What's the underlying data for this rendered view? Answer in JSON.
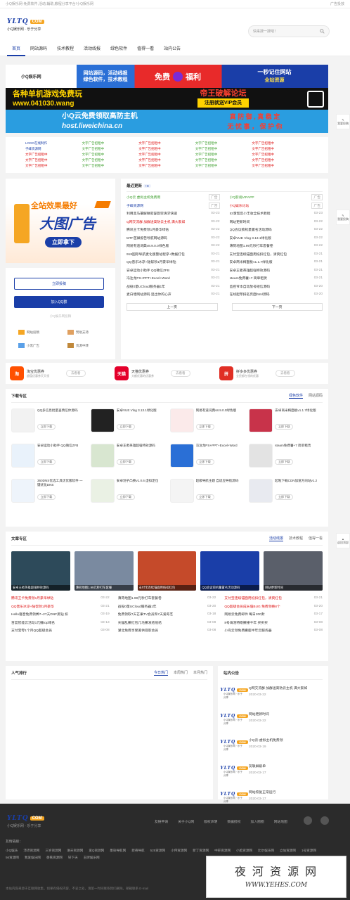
{
  "topbar": {
    "left": "小Q娱乐网-免费软件,活动,辅助,教程分享平台!小Q娱乐网",
    "right": "广告投放"
  },
  "logo": {
    "text": "YLTQ",
    "com": "COM",
    "sub": "小Q娱乐网 · 乐于分享"
  },
  "search": {
    "placeholder": "快来搜一搜吧！"
  },
  "nav": [
    "首页",
    "网站源码",
    "技术教程",
    "活动线报",
    "绿色软件",
    "值得一看",
    "站内公告"
  ],
  "banners": {
    "b1a": "小Q娱乐网",
    "b1b": "网站源码，活动线报",
    "b1c": "绿色软件，技术教程",
    "b1d": "免费",
    "b1e": "福利",
    "b1f": "一秒记住网站",
    "b1g": "全站资源",
    "b2a": "各种单机游戏免费玩",
    "b2b": "www.041030.wang",
    "b2c": "帝王破解论坛",
    "b2d": "注册就送VIP会员",
    "b3a": "小Q云免费领取高防主机",
    "b3b": "host.liweichina.cn",
    "b3c": "真 防 御 , 真 稳 定",
    "b3d": "无 忧 事 ， 保 护 你"
  },
  "textlinks": [
    [
      "LOGO在线制作",
      "文字广告招租中",
      "文字广告招租中",
      "文字广告招租中",
      "文字广告招租中"
    ],
    [
      "子峰资源网",
      "文字广告招租中",
      "文字广告招租中",
      "文字广告招租中",
      "文字广告招租中"
    ],
    [
      "文字广告招租中",
      "文字广告招租中",
      "文字广告招租中",
      "文字广告招租中",
      "文字广告招租中"
    ],
    [
      "文字广告招租中",
      "文字广告招租中",
      "文字广告招租中",
      "文字广告招租中",
      "文字广告招租中"
    ],
    [
      "文字广告招租中",
      "文字广告招租中",
      "文字广告招租中",
      "文字广告招租中",
      "文字广告招租中"
    ]
  ],
  "bigad": {
    "l1": "全站效果最好",
    "l2": "大图广告",
    "l3": "立即拿下"
  },
  "user": {
    "btn1": "立即投稿",
    "btn2": "加入QQ群",
    "sub": "小Q娱乐网投稿",
    "i1": "网站投稿",
    "i2": "赞助支持",
    "i3": "小黑广告",
    "i4": "资源中转"
  },
  "news": {
    "title": "最近更新",
    "badge": "+8",
    "left": [
      {
        "t": "小Q云 虚拟主机免费用",
        "d": "广告",
        "c": "g"
      },
      {
        "t": "子峰资源网",
        "d": "广告",
        "c": "b"
      },
      {
        "t": "利用黑马攘解微密容旋空请求快速",
        "d": "03-23",
        "c": ""
      },
      {
        "t": "Q网交流群 加群送高防云主机 满大家如",
        "d": "03-22",
        "c": "r"
      },
      {
        "t": "腾讯王卡免费领1月豪华绿钻",
        "d": "03-22",
        "c": ""
      },
      {
        "t": "MTF首屏报告导航网站源码",
        "d": "03-22",
        "c": ""
      },
      {
        "t": "网易有道词典v8.9.0.0绿色版",
        "d": "03-22",
        "c": ""
      },
      {
        "t": "918国际导航麦化版整站程序+数据打包",
        "d": "03-21",
        "c": ""
      },
      {
        "t": "QQ音乐冰凉+陆帮领1月豪华绿钻",
        "d": "03-21",
        "c": ""
      },
      {
        "t": "安卓运动小助手 QQ微信ZFB",
        "d": "03-21",
        "c": ""
      },
      {
        "t": "冯注龙PS+PPT+Excel+Word",
        "d": "03-21",
        "c": ""
      },
      {
        "t": "战役0量UCloud服务器1年",
        "d": "03-21",
        "c": ""
      },
      {
        "t": "麦白墙网站源码 追出你的心声",
        "d": "03-21",
        "c": ""
      }
    ],
    "right": [
      {
        "t": "小Q影视VIPAPP",
        "d": "广告",
        "c": "g"
      },
      {
        "t": "小Q娱乐论坛",
        "d": "广告",
        "c": "r"
      },
      {
        "t": "63掌帮您小丰收全技术教程",
        "d": "03-23",
        "c": ""
      },
      {
        "t": "网站更新时间",
        "d": "03-22",
        "c": ""
      },
      {
        "t": "QQ会议锁机量置名活动源码",
        "d": "03-22",
        "c": ""
      },
      {
        "t": "安卓VUE Vlog 3.13.1绿化版",
        "d": "03-22",
        "c": ""
      },
      {
        "t": "薄荷地图1.99元秒打车套餐卷",
        "d": "03-22",
        "c": ""
      },
      {
        "t": "支付宝连续锚面用抵扣红包，清爽红包",
        "d": "03-21",
        "c": ""
      },
      {
        "t": "安卓商米梅面板v1.1.7绿化版",
        "d": "03-21",
        "c": ""
      },
      {
        "t": "安卓王者英雄超强特效源码",
        "d": "03-21",
        "c": ""
      },
      {
        "t": "steam免费薯+7 简单租赁",
        "d": "03-21",
        "c": ""
      },
      {
        "t": "监控爷本自动放号短信源码",
        "d": "03-20",
        "c": ""
      },
      {
        "t": "在线起草排名页面html源码",
        "d": "03-20",
        "c": ""
      }
    ],
    "prev": "上一页",
    "next": "下一页"
  },
  "coupons": [
    {
      "icon": "淘",
      "title": "淘宝优惠券",
      "sub": "超值优惠券天天领",
      "btn": "去看看",
      "color": "#ff5000"
    },
    {
      "icon": "天猫",
      "title": "天猫优惠券",
      "sub": "大额优惠的优惠券",
      "btn": "去看看",
      "color": "#e4002b"
    },
    {
      "icon": "拼",
      "title": "拼多多优惠券",
      "sub": "全民都在领的优惠",
      "btn": "去看看",
      "color": "#e02e24"
    }
  ],
  "download": {
    "title": "下载专区",
    "tabs": [
      "绿色软件",
      "网站源码"
    ],
    "items": [
      {
        "t": "QQ多信息批量查情信体源码",
        "b": "立即下载",
        "c": "#f2f2f2"
      },
      {
        "t": "安卓VUE Vlog 3.13.1绿化版",
        "b": "立即下载",
        "c": "#222"
      },
      {
        "t": "网易有道词典v8.9.0.0绿色版",
        "b": "立即下载",
        "c": "#fbeaea"
      },
      {
        "t": "安卓商米梅面板v1.1.7绿化版",
        "b": "立即下载",
        "c": "#c8334a"
      },
      {
        "t": "安卓运动小助手 QQ微信ZFB",
        "b": "立即下载",
        "c": "#e9f2fb"
      },
      {
        "t": "安卓王者英雄超强特效源码",
        "b": "立即下载",
        "c": "#d8e6d0"
      },
      {
        "t": "冯注龙PS+PPT+Excel+Word",
        "b": "立即下载",
        "c": "#2a6fd6"
      },
      {
        "t": "steam免费薯+7 简单租赁",
        "b": "立即下载",
        "c": "#e3e3e3"
      },
      {
        "t": "360DNS优选工具优优版软件 一键优化DNS",
        "b": "立即下载",
        "c": "#eef4fb"
      },
      {
        "t": "安卓划子凸换v1.0.6 虚拟定位",
        "b": "立即下载",
        "c": "#eaf1e4"
      },
      {
        "t": "超级导航主题 自适应导航源码",
        "b": "立即下载",
        "c": "#f4f4f4"
      },
      {
        "t": "起啦下载CDN加速方向站v1.2",
        "b": "立即下载",
        "c": "#e8eaf0"
      }
    ]
  },
  "articles": {
    "title": "文章专区",
    "tabs": [
      "活动线报",
      "技术教程",
      "值得一看"
    ],
    "thumbs": [
      {
        "t": "安卓王者英雄超强特效源码",
        "c": "#2d4a5a"
      },
      {
        "t": "薄荷地图1.99元秒打车套餐",
        "c": "#7a8aa0"
      },
      {
        "t": "支付宝连续锚面用抵扣红包",
        "c": "#c54a2a"
      },
      {
        "t": "QQ会议锁机量置名活动源码",
        "c": "#1a3ea8"
      },
      {
        "t": "网站更新时间",
        "c": "#5a5f6a"
      }
    ],
    "rows": [
      [
        {
          "t": "腾讯王卡免费领1月豪华绿钻",
          "d": "03-22",
          "c": "r"
        },
        {
          "t": "薄荷地图1.99元秒打车套餐卷",
          "d": "03-22",
          "c": ""
        },
        {
          "t": "支付宝连续锚面用抵扣红包，清爽红包",
          "d": "03-21",
          "c": "r"
        }
      ],
      [
        {
          "t": "QQ音乐冰凉+陆帮领1月豪华",
          "d": "03-21",
          "c": "r"
        },
        {
          "t": "战役0量UCloud服务器1年",
          "d": "03-20",
          "c": ""
        },
        {
          "t": "QQ超级会员成长值BUG 免费领换8个",
          "d": "03-20",
          "c": "r"
        }
      ],
      [
        {
          "t": "Hello语音免费领绑7~27天DNF黑钻 扣",
          "d": "03-19",
          "c": ""
        },
        {
          "t": "免费领取7天芒果TV会员和7天爱奇艺",
          "d": "03-18",
          "c": ""
        },
        {
          "t": "网易云免费邮件 每日200封",
          "d": "03-17",
          "c": ""
        }
      ],
      [
        {
          "t": "百度智能云活动1元撸top域名",
          "d": "03-13",
          "c": ""
        },
        {
          "t": "天猫乱撒红包几毛撒发给他给",
          "d": "03-08",
          "c": ""
        },
        {
          "t": "8号海泡特刚撒撞千年 买买买",
          "d": "03-08",
          "c": ""
        }
      ],
      [
        {
          "t": "支付宝零1个月QQ超级会员",
          "d": "03-08",
          "c": ""
        },
        {
          "t": "湖北免费享受美供观影会员",
          "d": "03-08",
          "c": ""
        },
        {
          "t": "小鸟云领免费撒鹿半年云服务器",
          "d": "03-08",
          "c": ""
        }
      ]
    ]
  },
  "popular": {
    "title": "人气排行",
    "tabs": [
      "今日热门",
      "本周热门",
      "本月热门"
    ]
  },
  "notice": {
    "title": "站内公告",
    "items": [
      {
        "t": "Q网交流群 加群送高防云主机 满大家如",
        "d": "2020-03-22"
      },
      {
        "t": "网站更新时间",
        "d": "2020-03-22"
      },
      {
        "t": "小Q云-虚拟主机免费领",
        "d": "2020-03-19"
      },
      {
        "t": "友联屏蔽单",
        "d": "2020-03-17"
      },
      {
        "t": "网站恢复正常运行",
        "d": "2020-03-17"
      }
    ]
  },
  "footer": {
    "menu": [
      "友链申请",
      "关于小Q网",
      "版权声明",
      "数据授权",
      "加入圈圈",
      "网站地图"
    ],
    "label": "友情链接：",
    "links": [
      "小Q娱乐",
      "沛沛资源网",
      "三岁资源网",
      "进天资源网",
      "爱Q资源网",
      "墨染导航网",
      "新奇导航",
      "525资源网",
      "小伟资源网",
      "新丁资源网",
      "中轩资源网",
      "小脸资源网",
      "比尔娱乐网",
      "立站资源网",
      "1号资源网",
      "56资源网",
      "我爱娱乐网",
      "香蕉资源网",
      "轩下天",
      "王牌娱乐网"
    ],
    "copyright": "本站内容来源于互联网收集，如果有侵权内容，不妥之处，请第一时间联系我们删除。邮箱联系 E-mail"
  },
  "side": [
    "我要投稿",
    "我要投稿",
    "返回顶部"
  ],
  "watermark": {
    "l1": "夜 河 资 源 网",
    "l2": "WWW.YEHES.COM"
  }
}
